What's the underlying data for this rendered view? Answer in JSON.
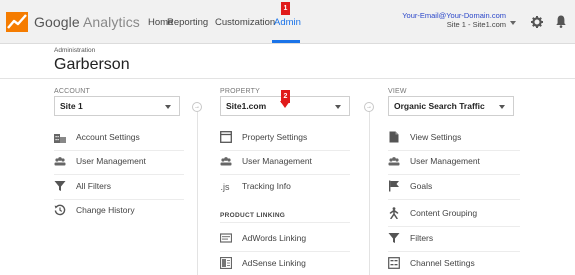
{
  "header": {
    "brand_first": "Google",
    "brand_second": "Analytics",
    "nav": [
      {
        "label": "Home"
      },
      {
        "label": "Reporting"
      },
      {
        "label": "Customization"
      },
      {
        "label": "Admin",
        "active": true
      }
    ],
    "account_email": "Your-Email@Your-Domain.com",
    "account_sub": "Site 1 - Site1.com",
    "accent_color": "#1a73e8"
  },
  "annotations": {
    "badge1": "1",
    "badge2": "2"
  },
  "page": {
    "section_label": "Administration",
    "title": "Garberson"
  },
  "columns": {
    "account": {
      "label": "ACCOUNT",
      "selected": "Site 1",
      "items": [
        "Account Settings",
        "User Management",
        "All Filters",
        "Change History"
      ]
    },
    "property": {
      "label": "PROPERTY",
      "selected": "Site1.com",
      "items": [
        "Property Settings",
        "User Management",
        "Tracking Info"
      ],
      "section": "PRODUCT LINKING",
      "linking": [
        "AdWords Linking",
        "AdSense Linking"
      ]
    },
    "view": {
      "label": "VIEW",
      "selected": "Organic Search Traffic",
      "items": [
        "View Settings",
        "User Management",
        "Goals",
        "Content Grouping",
        "Filters",
        "Channel Settings"
      ]
    }
  }
}
